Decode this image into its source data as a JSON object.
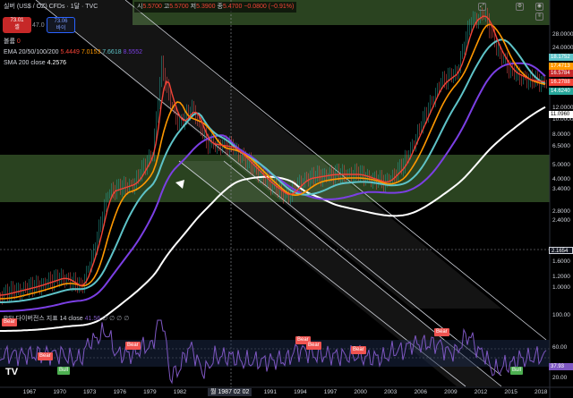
{
  "header": {
    "symbol": "실버 (US$ / OZ) CFDs · 1달 · TVC",
    "ohlc_open_label": "시",
    "ohlc_open": "5.5700",
    "ohlc_high_label": "고",
    "ohlc_high": "5.5700",
    "ohlc_low_label": "저",
    "ohlc_low": "5.3900",
    "ohlc_close_label": "종",
    "ohlc_close": "5.4700",
    "ohlc_change": "−0.0800 (−0.91%)"
  },
  "trade": {
    "sell_price": "73.01",
    "sell_label": "셀",
    "spread": "47.0",
    "buy_price": "73.06",
    "buy_label": "바이"
  },
  "indicators": {
    "volume_label": "볼륨",
    "volume_value": "0",
    "ema_label": "EMA 20/50/100/200",
    "ema_values": [
      "5.4449",
      "7.0153",
      "7.6618",
      "8.5552"
    ],
    "sma_label": "SMA 200 close",
    "sma_value": "4.2576"
  },
  "rsi": {
    "label": "RSI 다이버전스 지표 14 close",
    "value": "41.56",
    "icons": "∅ ∅ ∅ ∅",
    "axis_ticks": [
      "100.00",
      "60.00",
      "20.00"
    ],
    "current_tag": "37.93",
    "badges": [
      {
        "label": "Bear",
        "kind": "bear"
      },
      {
        "label": "Bear",
        "kind": "bear"
      },
      {
        "label": "Bull",
        "kind": "bull"
      },
      {
        "label": "Bear",
        "kind": "bear"
      },
      {
        "label": "Bear",
        "kind": "bear"
      },
      {
        "label": "Bear",
        "kind": "bear"
      },
      {
        "label": "Bear",
        "kind": "bear"
      },
      {
        "label": "Bear",
        "kind": "bear"
      },
      {
        "label": "Bull",
        "kind": "bull"
      }
    ]
  },
  "price_axis": {
    "ticks": [
      "28.0000",
      "24.0000",
      "12.0000",
      "10.0000",
      "8.0000",
      "6.5000",
      "5.0000",
      "4.0000",
      "3.4000",
      "2.8000",
      "2.4000",
      "1.6000",
      "1.2000",
      "1.0000"
    ],
    "tags": [
      {
        "label": "18.1752",
        "color": "#5ec3c8"
      },
      {
        "label": "17.4713",
        "color": "#ff9800"
      },
      {
        "label": "16.5784",
        "color": "#c62828"
      },
      {
        "label": "16.2788",
        "color": "#f44336"
      },
      {
        "label": "14.6240",
        "color": "#26a69a"
      },
      {
        "label": "11.0960",
        "color": "#ffffff"
      },
      {
        "label": "2.1654",
        "color": "#131722"
      }
    ]
  },
  "time_axis": {
    "ticks": [
      "1967",
      "1970",
      "1973",
      "1976",
      "1979",
      "1982",
      "1985",
      "1988",
      "1991",
      "1994",
      "1997",
      "2000",
      "2003",
      "2006",
      "2009",
      "2012",
      "2015",
      "2018"
    ],
    "cursor_label": "월 1987 02 02"
  },
  "colors": {
    "ema20": "#f44336",
    "ema50": "#ff9800",
    "ema100": "#5ec3c8",
    "ema200": "#7b3fe4",
    "sma200": "#ffffff",
    "zone": "#4c7a3a",
    "rsi_line": "#7e57c2"
  },
  "logo": "TV"
}
